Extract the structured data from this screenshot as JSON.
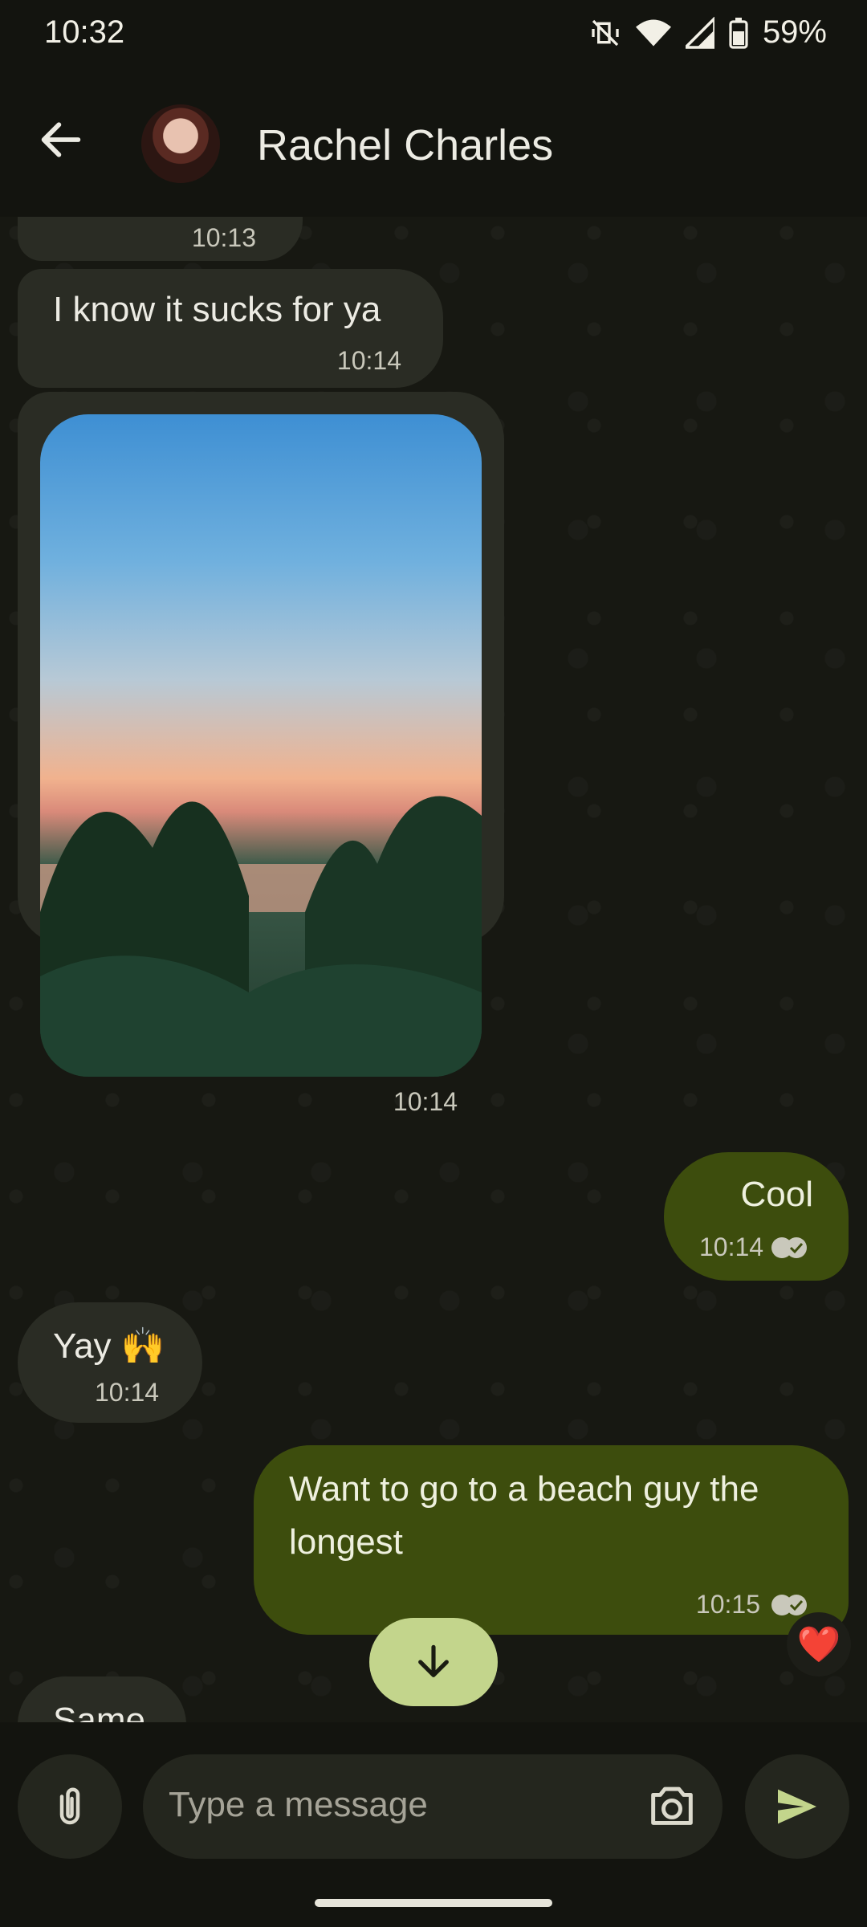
{
  "status_bar": {
    "time": "10:32",
    "battery_percent": "59%",
    "icons": [
      "vibrate-off-icon",
      "wifi-icon",
      "signal-icon",
      "battery-icon"
    ]
  },
  "header": {
    "contact_name": "Rachel Charles",
    "back_icon": "arrow-left-icon"
  },
  "messages": [
    {
      "direction": "in",
      "text": "",
      "time": "10:13"
    },
    {
      "direction": "in",
      "text": "I know it sucks for ya",
      "time": "10:14"
    },
    {
      "direction": "in",
      "type": "image",
      "text": "",
      "time": "10:14"
    },
    {
      "direction": "out",
      "text": "Cool",
      "time": "10:14",
      "read": true
    },
    {
      "direction": "in",
      "text": "Yay 🙌",
      "time": "10:14"
    },
    {
      "direction": "out",
      "text": "Want to go to a beach guy the longest",
      "time": "10:15",
      "read": true,
      "reaction": "❤️"
    },
    {
      "direction": "in",
      "text": "Same",
      "time": ""
    }
  ],
  "composer": {
    "placeholder": "Type a message",
    "attach_icon": "paperclip-icon",
    "camera_icon": "camera-icon",
    "send_icon": "send-icon"
  },
  "colors": {
    "background": "#13140f",
    "incoming_bubble": "#2a2c24",
    "outgoing_bubble": "#3d4d0d",
    "scroll_button": "#c3d58c",
    "send_accent": "#c3d58c"
  }
}
